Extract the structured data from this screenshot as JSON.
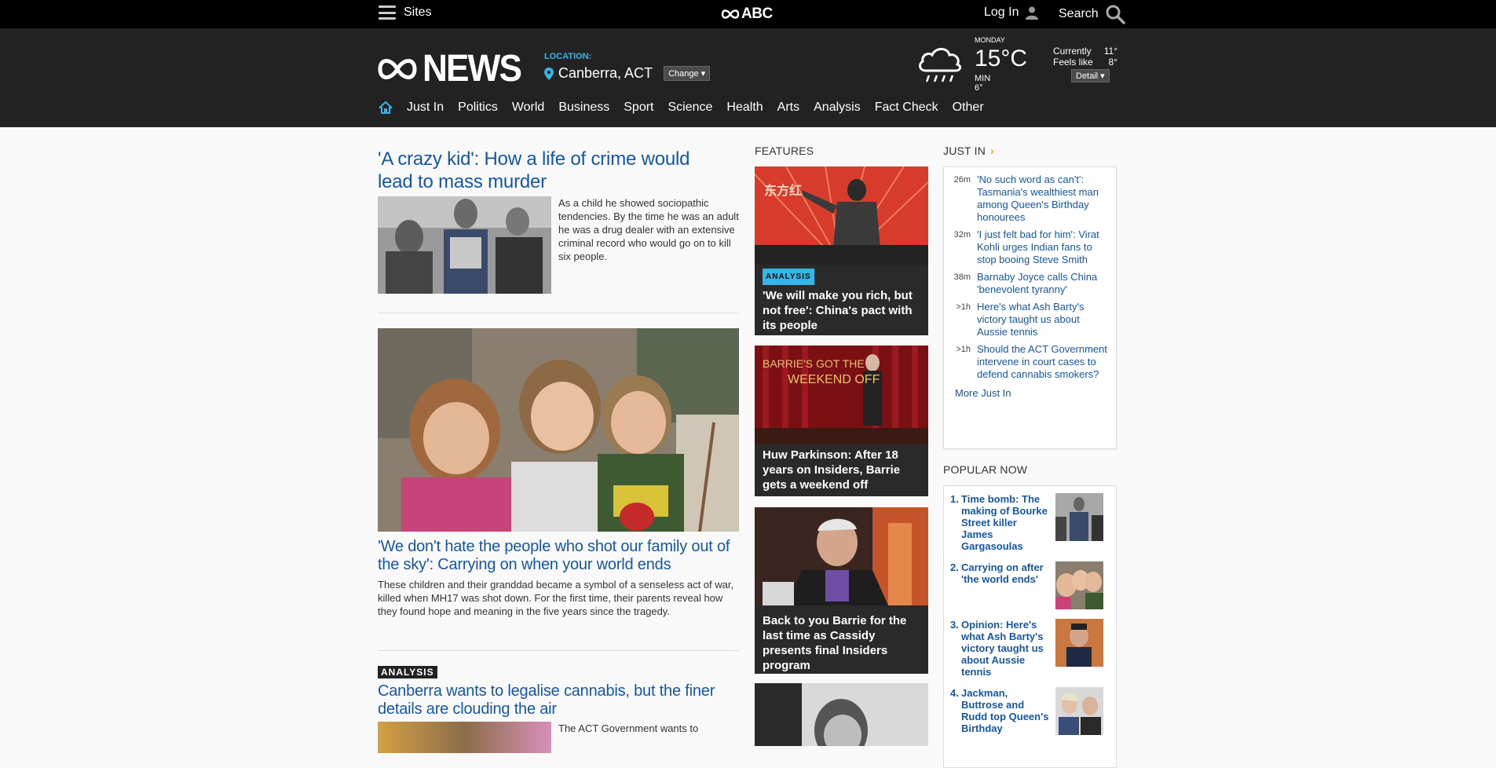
{
  "topbar": {
    "sites_label": "Sites",
    "brand": "ABC",
    "login_label": "Log In",
    "search_label": "Search"
  },
  "header": {
    "logo_text": "NEWS",
    "location_label": "LOCATION:",
    "location_city": "Canberra, ACT",
    "change_label": "Change",
    "weather": {
      "day": "MONDAY",
      "temp": "15°C",
      "min": "MIN 6°",
      "currently_label": "Currently",
      "currently_value": "11°",
      "feels_label": "Feels like",
      "feels_value": "8°",
      "detail_label": "Detail"
    }
  },
  "nav": {
    "items": [
      "Just In",
      "Politics",
      "World",
      "Business",
      "Sport",
      "Science",
      "Health",
      "Arts",
      "Analysis",
      "Fact Check",
      "Other"
    ]
  },
  "main": {
    "story1": {
      "headline": "'A crazy kid': How a life of crime would lead to mass murder",
      "blurb": "As a child he showed sociopathic tendencies. By the time he was an adult he was a drug dealer with an extensive criminal record who would go on to kill six people."
    },
    "story2": {
      "headline": "'We don't hate the people who shot our family out of the sky': Carrying on when your world ends",
      "blurb": "These children and their granddad became a symbol of a senseless act of war, killed when MH17 was shot down. For the first time, their parents reveal how they found hope and meaning in the five years since the tragedy."
    },
    "story3": {
      "badge": "ANALYSIS",
      "headline": "Canberra wants to legalise cannabis, but the finer details are clouding the air",
      "blurb": "The ACT Government wants to"
    }
  },
  "features": {
    "title": "FEATURES",
    "items": [
      {
        "badge": "ANALYSIS",
        "title": "'We will make you rich, but not free': China's pact with its people",
        "image_text": "东方红"
      },
      {
        "title": "Huw Parkinson: After 18 years on Insiders, Barrie gets a weekend off",
        "image_text_top": "BARRIE'S GOT THE",
        "image_text_bottom": "WEEKEND OFF"
      },
      {
        "title": "Back to you Barrie for the last time as Cassidy presents final Insiders program"
      }
    ]
  },
  "justin": {
    "title": "JUST IN",
    "items": [
      {
        "time": "26m",
        "text": "'No such word as can't': Tasmania's wealthiest man among Queen's Birthday honourees"
      },
      {
        "time": "32m",
        "text": "'I just felt bad for him': Virat Kohli urges Indian fans to stop booing Steve Smith"
      },
      {
        "time": "38m",
        "text": "Barnaby Joyce calls China 'benevolent tyranny'"
      },
      {
        "time": ">1h",
        "text": "Here's what Ash Barty's victory taught us about Aussie tennis"
      },
      {
        "time": ">1h",
        "text": "Should the ACT Government intervene in court cases to defend cannabis smokers?"
      }
    ],
    "more_label": "More Just In"
  },
  "popular": {
    "title": "POPULAR NOW",
    "items": [
      {
        "num": "1.",
        "text": "Time bomb: The making of Bourke Street killer James Gargasoulas"
      },
      {
        "num": "2.",
        "text": "Carrying on after 'the world ends'"
      },
      {
        "num": "3.",
        "text": "Opinion: Here's what Ash Barty's victory taught us about Aussie tennis"
      },
      {
        "num": "4.",
        "text": "Jackman, Buttrose and Rudd top Queen's Birthday"
      }
    ]
  }
}
